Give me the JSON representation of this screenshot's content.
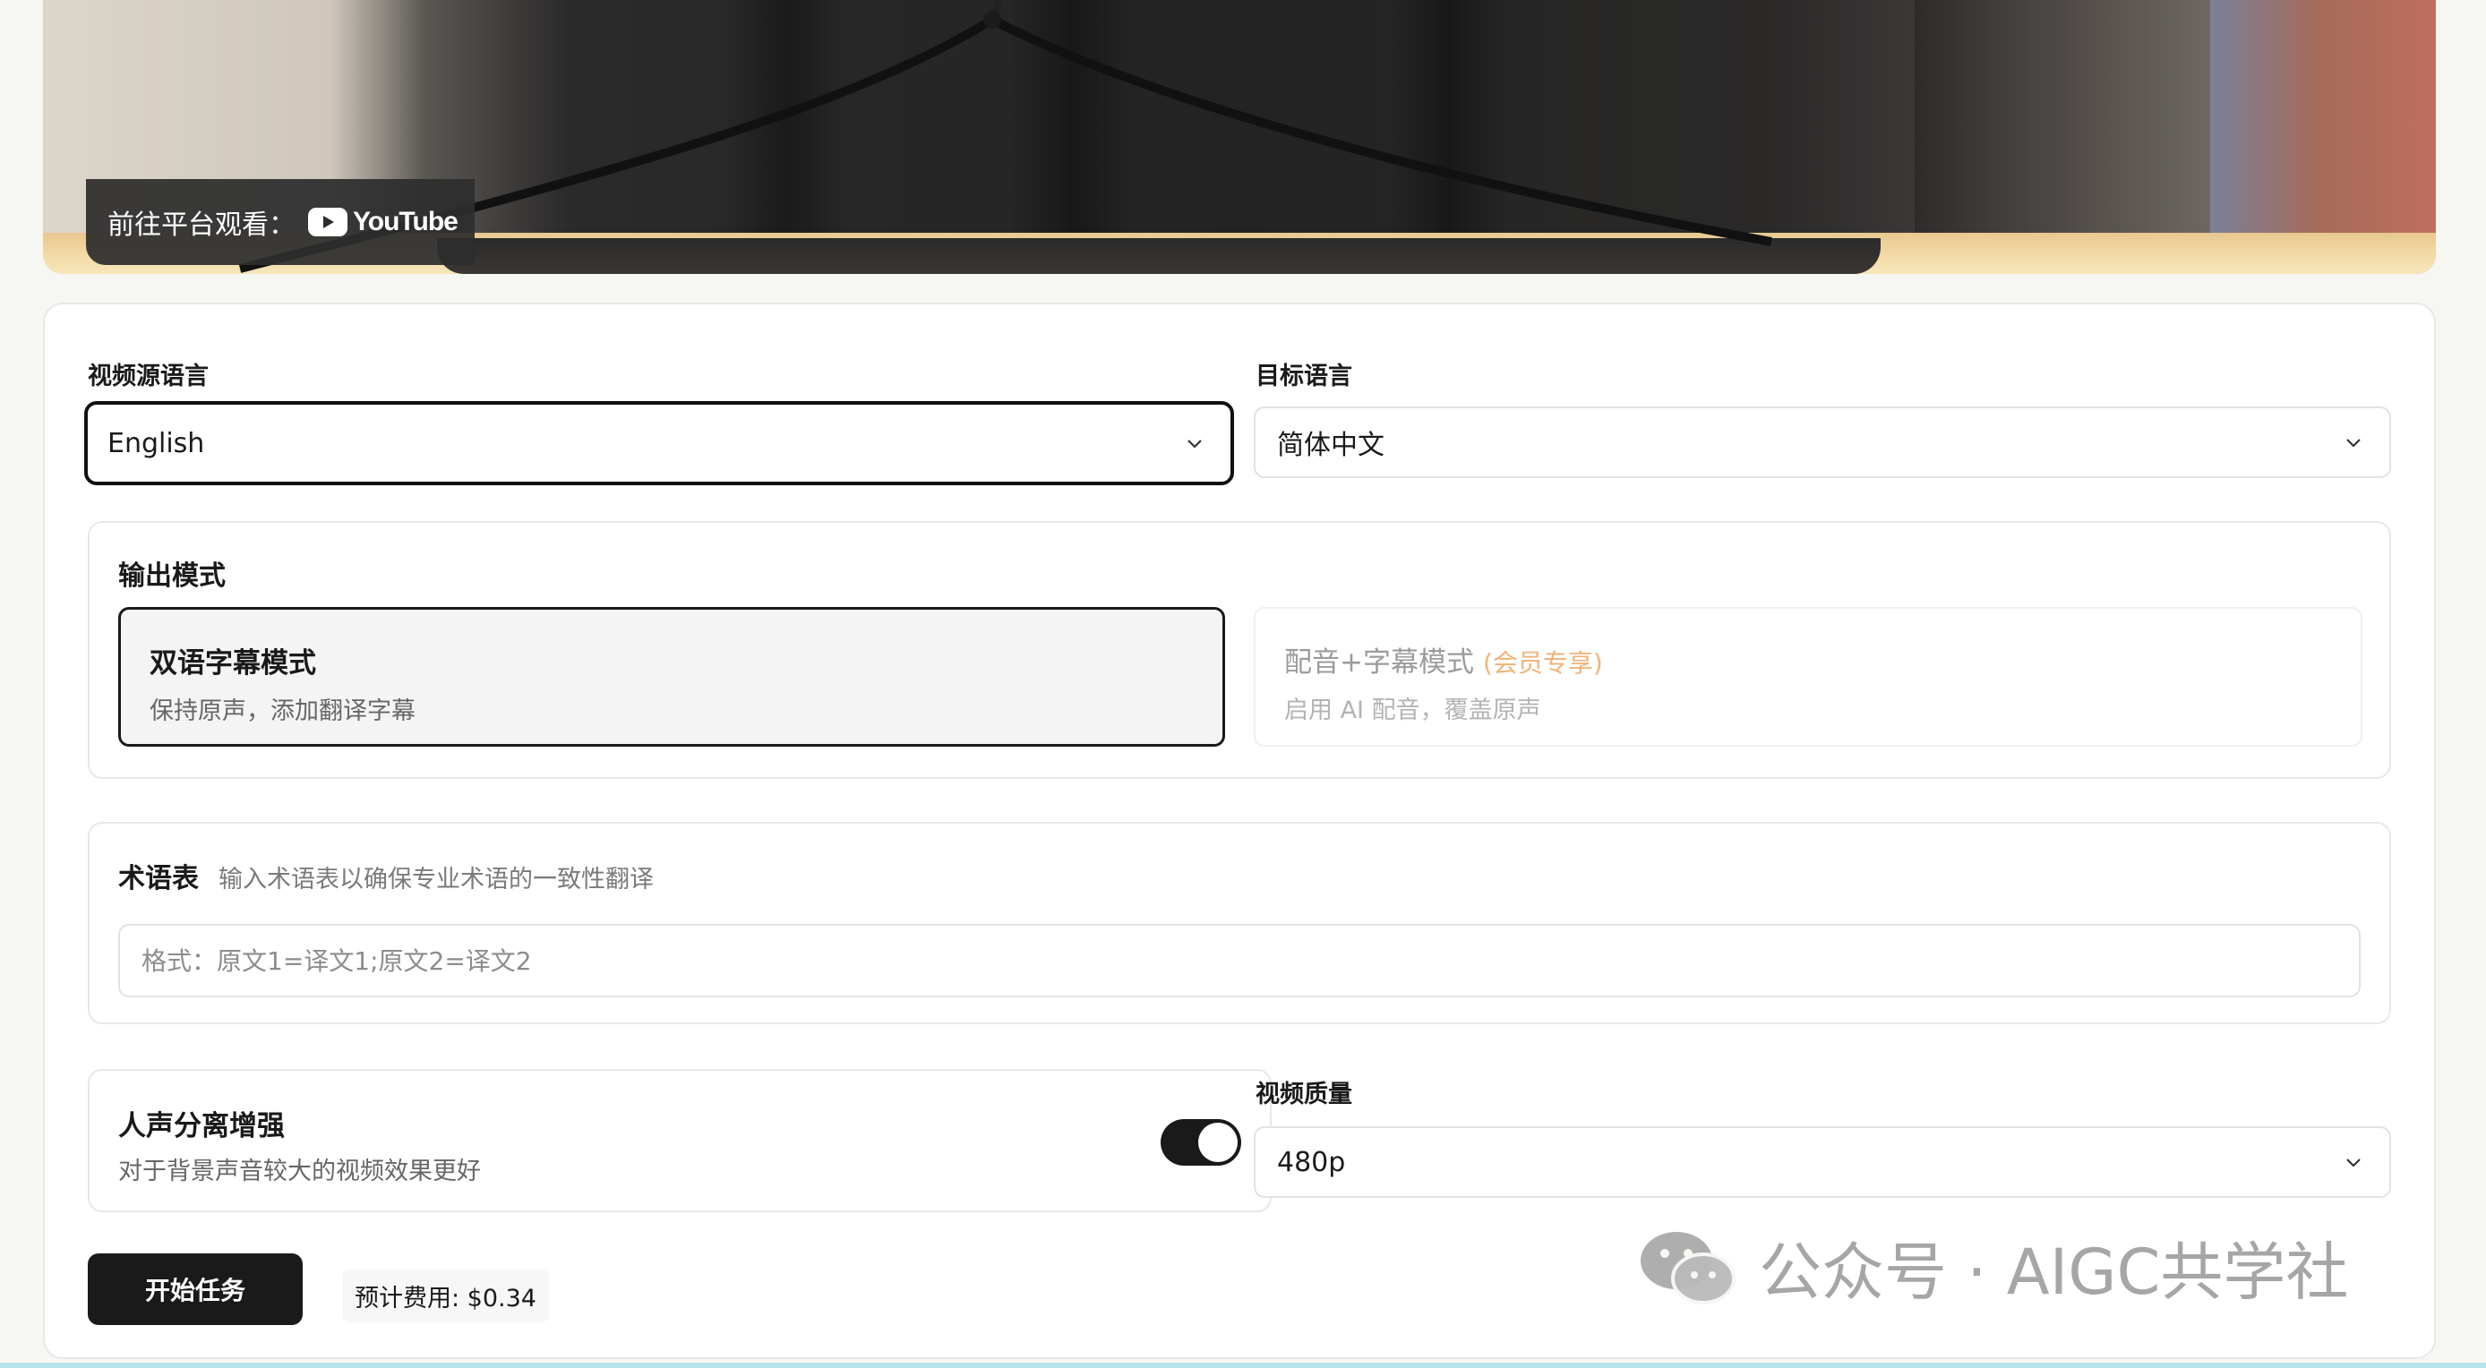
{
  "video": {
    "platform_prefix": "前往平台观看：",
    "platform_name": "YouTube"
  },
  "source_language": {
    "label": "视频源语言",
    "value": "English"
  },
  "target_language": {
    "label": "目标语言",
    "value": "简体中文"
  },
  "output_mode": {
    "title": "输出模式",
    "options": [
      {
        "title": "双语字幕模式",
        "description": "保持原声，添加翻译字幕",
        "selected": true
      },
      {
        "title": "配音+字幕模式",
        "tag": "(会员专享)",
        "description": "启用 AI 配音，覆盖原声",
        "selected": false
      }
    ]
  },
  "glossary": {
    "title": "术语表",
    "hint": "输入术语表以确保专业术语的一致性翻译",
    "placeholder": "格式：原文1=译文1;原文2=译文2",
    "value": ""
  },
  "voice_separation": {
    "title": "人声分离增强",
    "description": "对于背景声音较大的视频效果更好",
    "enabled": true
  },
  "video_quality": {
    "label": "视频质量",
    "value": "480p"
  },
  "actions": {
    "start_label": "开始任务",
    "cost_text": "预计费用: $0.34"
  },
  "watermark": {
    "text": "公众号 · AIGC共学社",
    "icon": "wechat-icon"
  },
  "colors": {
    "accent": "#1a1a1a",
    "member_tag": "#f0b37a",
    "youtube_red": "#ffffff"
  }
}
